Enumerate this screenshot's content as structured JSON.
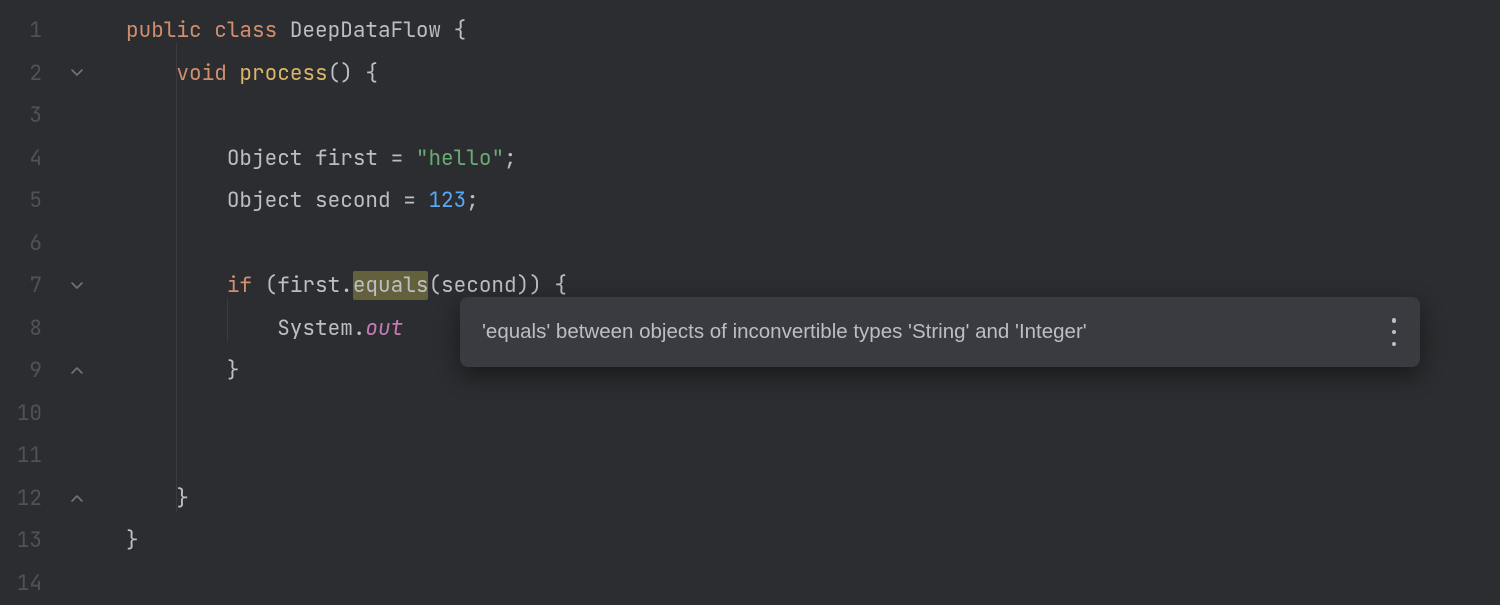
{
  "lines": [
    "1",
    "2",
    "3",
    "4",
    "5",
    "6",
    "7",
    "8",
    "9",
    "10",
    "11",
    "12",
    "13",
    "14"
  ],
  "fold": {
    "line2": "open",
    "line7": "open",
    "line9": "close",
    "line12": "close"
  },
  "code": {
    "l1": {
      "public": "public",
      "class": "class",
      "name": "DeepDataFlow",
      "open": " {"
    },
    "l2": {
      "void": "void",
      "method": "process",
      "sig": "() {"
    },
    "l4": {
      "type": "Object",
      "var": "first",
      "eq": " = ",
      "str": "\"hello\"",
      "semi": ";"
    },
    "l5": {
      "type": "Object",
      "var": "second",
      "eq": " = ",
      "num": "123",
      "semi": ";"
    },
    "l7": {
      "if": "if",
      "open": " (",
      "obj": "first",
      "dot": ".",
      "call": "equals",
      "args": "(second)) {"
    },
    "l8": {
      "sys": "System",
      "dot": ".",
      "out": "out"
    },
    "l9": {
      "close": "}"
    },
    "l12": {
      "close": "}"
    },
    "l13": {
      "close": "}"
    }
  },
  "tooltip": {
    "text": "'equals' between objects of inconvertible types 'String' and 'Integer'"
  }
}
